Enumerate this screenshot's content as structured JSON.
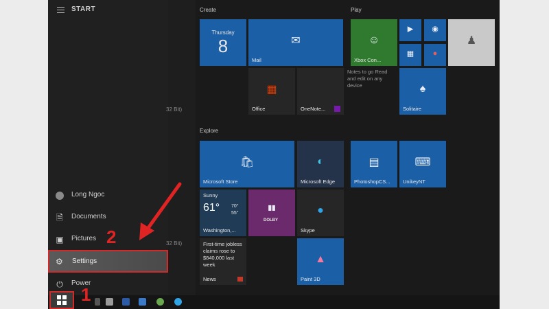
{
  "start": {
    "title": "START"
  },
  "applist": {
    "bit_label_1": "32 Bit)",
    "bit_label_2": "32 Bit)"
  },
  "rail": {
    "user": "Long Ngoc",
    "documents": "Documents",
    "pictures": "Pictures",
    "settings": "Settings",
    "power": "Power"
  },
  "groups": {
    "create": "Create",
    "play": "Play",
    "explore": "Explore"
  },
  "tiles": {
    "calendar": {
      "day": "Thursday",
      "date": "8"
    },
    "mail": "Mail",
    "office": "Office",
    "onenote": "OneNote...",
    "notes": "Notes to go Read and edit on any device",
    "xbox": "Xbox Con...",
    "solitaire": "Solitaire",
    "store": "Microsoft Store",
    "edge": "Microsoft Edge",
    "photoshop": "PhotoshopCS...",
    "unikey": "UnikeyNT",
    "weather": {
      "condition": "Sunny",
      "temp": "61°",
      "high": "70°",
      "low": "55°",
      "city": "Washington,..."
    },
    "dolby": "DOLBY",
    "skype": "Skype",
    "news": {
      "headline": "First-time jobless claims rose to $840,000 last week",
      "label": "News"
    },
    "paint3d": "Paint 3D"
  },
  "annotations": {
    "step1": "1",
    "step2": "2"
  },
  "colors": {
    "accent": "#1b5fa7",
    "highlight": "#d12a2a"
  }
}
